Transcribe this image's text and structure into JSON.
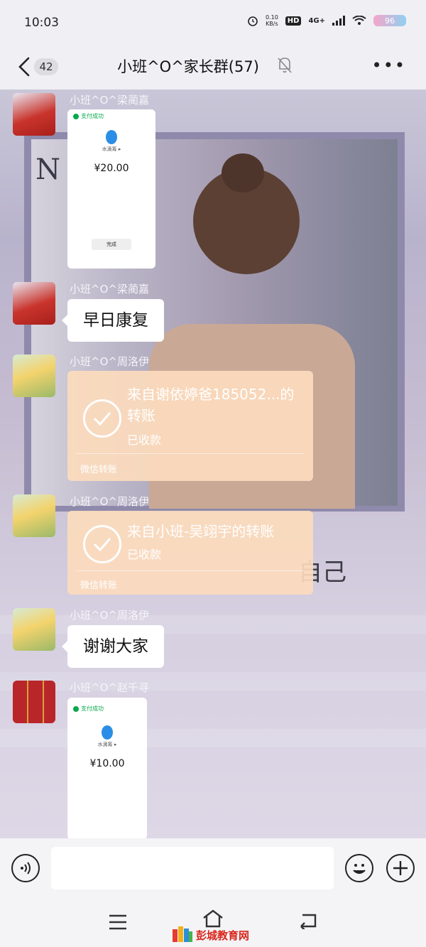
{
  "status_bar": {
    "time": "10:03",
    "net_speed_value": "0.10",
    "net_speed_unit": "KB/s",
    "hd_badge": "HD",
    "signal": "4G+",
    "battery": "96"
  },
  "nav": {
    "back_count": "42",
    "title": "小班^O^家长群(57)"
  },
  "background": {
    "photo_sign": "N",
    "overlay_text": "自己"
  },
  "messages": [
    {
      "sender": "小班^O^梁蔺嘉",
      "type": "screenshot",
      "pay_status": "支付成功",
      "merchant": "水滴筹 ▸",
      "amount": "¥20.00",
      "done_button": "完成"
    },
    {
      "sender": "小班^O^梁蔺嘉",
      "type": "text",
      "text": "早日康复"
    },
    {
      "sender": "小班^O^周洛伊",
      "type": "transfer",
      "title": "来自谢依婷爸185052...的转账",
      "status": "已收款",
      "footer": "微信转账"
    },
    {
      "sender": "小班^O^周洛伊",
      "type": "transfer",
      "title": "来自小班-吴翊宇的转账",
      "status": "已收款",
      "footer": "微信转账"
    },
    {
      "sender": "小班^O^周洛伊",
      "type": "text",
      "text": "谢谢大家"
    },
    {
      "sender": "小班^O^赵千寻",
      "type": "screenshot",
      "pay_status": "支付成功",
      "merchant": "水滴筹 ▸",
      "amount": "¥10.00"
    }
  ],
  "watermark": "彭城教育网",
  "icons": [
    "back-arrow-icon",
    "mute-bell-icon",
    "more-icon",
    "voice-icon",
    "emoji-icon",
    "plus-icon",
    "menu-icon",
    "home-icon",
    "return-icon",
    "check-icon",
    "alarm-icon",
    "wifi-icon",
    "signal-icon"
  ]
}
